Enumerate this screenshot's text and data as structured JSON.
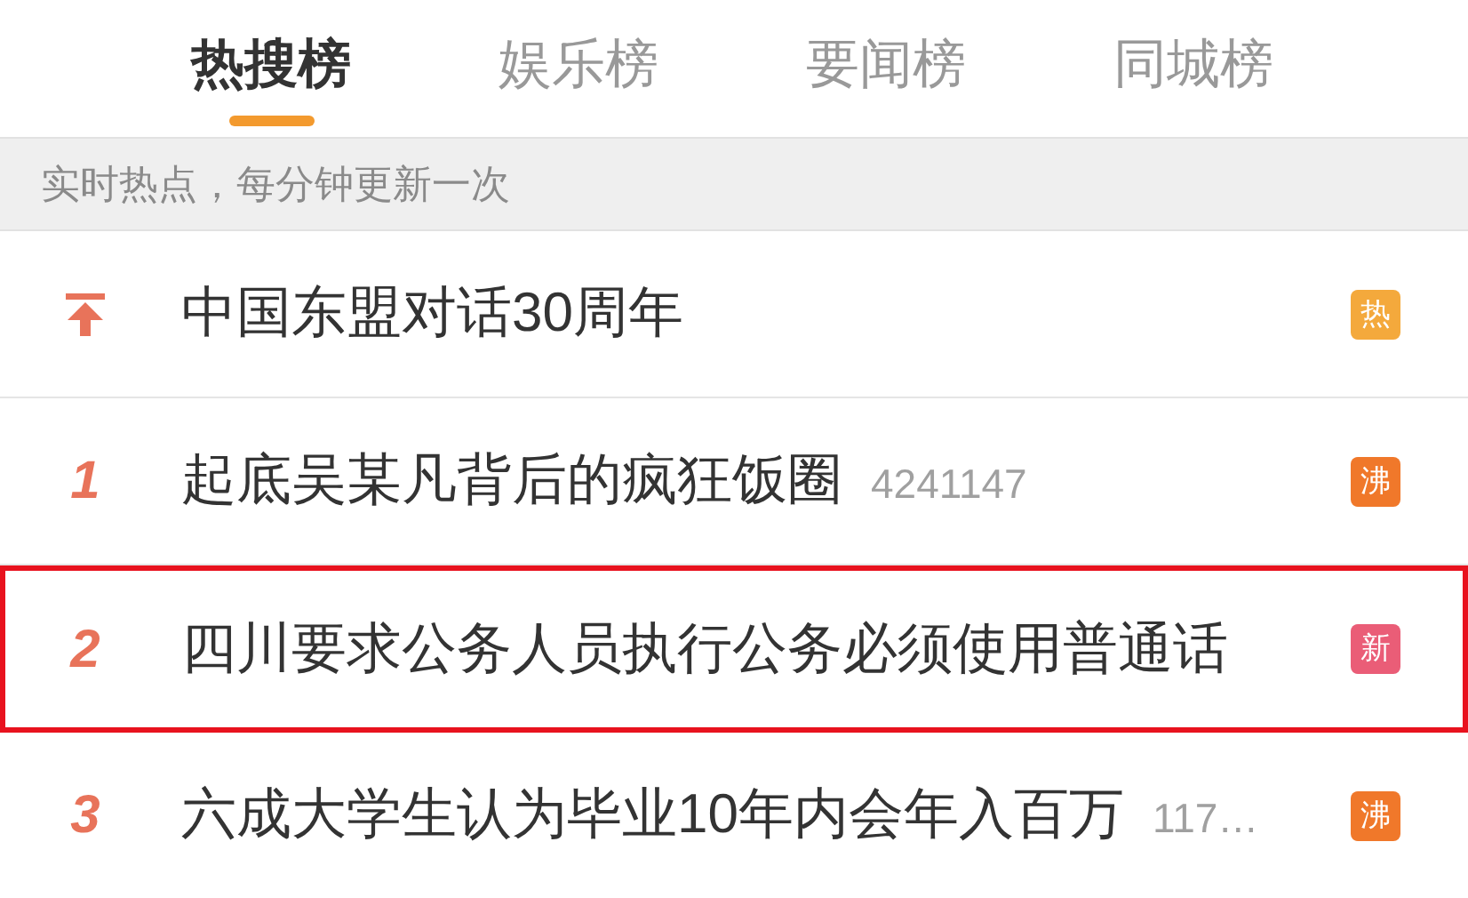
{
  "tabs": [
    {
      "label": "热搜榜",
      "selected": true
    },
    {
      "label": "娱乐榜",
      "selected": false
    },
    {
      "label": "要闻榜",
      "selected": false
    },
    {
      "label": "同城榜",
      "selected": false
    }
  ],
  "notice": "实时热点，每分钟更新一次",
  "rows": [
    {
      "kind": "pinned",
      "title": "中国东盟对话30周年",
      "badge": {
        "label": "热",
        "color": "#f4a93c"
      },
      "highlighted": false
    },
    {
      "kind": "ranked",
      "rank": "1",
      "title": "起底吴某凡背后的疯狂饭圈",
      "heat": "4241147",
      "badge": {
        "label": "沸",
        "color": "#f0782a"
      },
      "highlighted": false
    },
    {
      "kind": "ranked",
      "rank": "2",
      "title": "四川要求公务人员执行公务必须使用普通话",
      "badge": {
        "label": "新",
        "color": "#ea5d77"
      },
      "highlighted": true
    },
    {
      "kind": "ranked",
      "rank": "3",
      "title": "六成大学生认为毕业10年内会年入百万",
      "heat": "117…",
      "badge": {
        "label": "沸",
        "color": "#f0782a"
      },
      "highlighted": false
    }
  ]
}
